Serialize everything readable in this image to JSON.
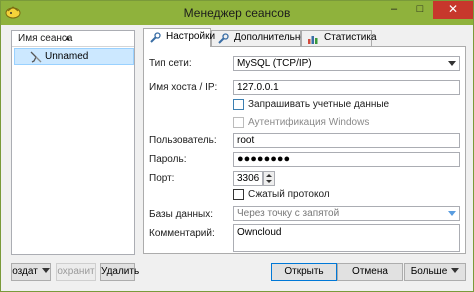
{
  "window": {
    "title": "Менеджер сеансов",
    "minimize_label": "–",
    "maximize_label": "□",
    "close_label": "✕",
    "accent_color": "#8fb23c"
  },
  "sessions": {
    "column_header": "Имя сеанса",
    "items": [
      {
        "label": "Unnamed"
      }
    ]
  },
  "tabs": [
    {
      "label": "Настройки",
      "icon": "wrench-icon",
      "active": true
    },
    {
      "label": "Дополнительно",
      "icon": "wrench-icon",
      "active": false
    },
    {
      "label": "Статистика",
      "icon": "bar-chart-icon",
      "active": false
    }
  ],
  "settings": {
    "network_type_label": "Тип сети:",
    "network_type_value": "MySQL (TCP/IP)",
    "host_label": "Имя хоста / IP:",
    "host_value": "127.0.0.1",
    "prompt_credentials_label": "Запрашивать учетные данные",
    "prompt_credentials_checked": false,
    "windows_auth_label": "Аутентификация Windows",
    "windows_auth_checked": false,
    "user_label": "Пользователь:",
    "user_value": "root",
    "password_label": "Пароль:",
    "password_value": "●●●●●●●●",
    "port_label": "Порт:",
    "port_value": "3306",
    "compressed_label": "Сжатый протокол",
    "compressed_checked": false,
    "databases_label": "Базы данных:",
    "databases_placeholder": "Через точку с запятой",
    "comment_label": "Комментарий:",
    "comment_value": "Owncloud"
  },
  "buttons": {
    "new_label": "оздат",
    "save_label": "охранит",
    "delete_label": "Удалить",
    "open_label": "Открыть",
    "cancel_label": "Отмена",
    "more_label": "Больше"
  }
}
